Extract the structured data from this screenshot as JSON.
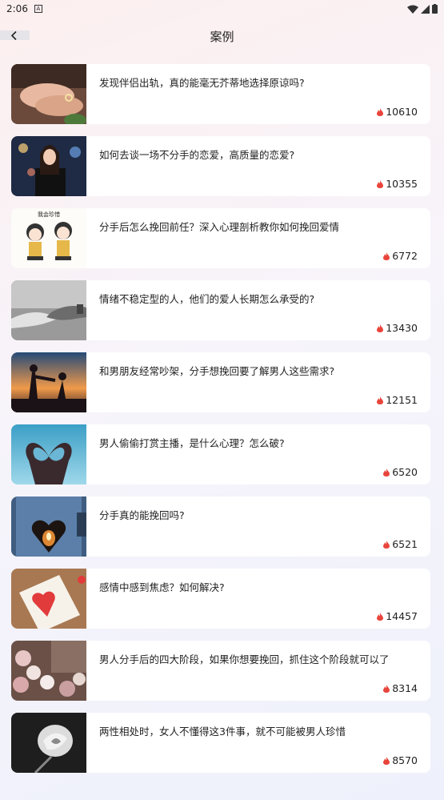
{
  "status": {
    "time": "2:06",
    "badge": "A"
  },
  "header": {
    "title": "案例"
  },
  "cases": [
    {
      "title": "发现伴侣出轨，真的能毫无芥蒂地选择原谅吗?",
      "views": "10610",
      "img": "hands"
    },
    {
      "title": "如何去谈一场不分手的恋爱，高质量的恋爱?",
      "views": "10355",
      "img": "woman"
    },
    {
      "title": "分手后怎么挽回前任？深入心理剖析教你如何挽回爱情",
      "views": "6772",
      "img": "cartoon",
      "img_text": "我会珍惜"
    },
    {
      "title": "情绪不稳定型的人，他们的爱人长期怎么承受的?",
      "views": "13430",
      "img": "handhold"
    },
    {
      "title": "和男朋友经常吵架，分手想挽回要了解男人这些需求?",
      "views": "12151",
      "img": "sunset"
    },
    {
      "title": "男人偷偷打赏主播，是什么心理？怎么破?",
      "views": "6520",
      "img": "heartsky"
    },
    {
      "title": "分手真的能挽回吗?",
      "views": "6521",
      "img": "heartdoor"
    },
    {
      "title": "感情中感到焦虑？如何解决?",
      "views": "14457",
      "img": "heartcard"
    },
    {
      "title": "男人分手后的四大阶段，如果你想要挽回，抓住这个阶段就可以了",
      "views": "8314",
      "img": "flowers"
    },
    {
      "title": "两性相处时，女人不懂得这3件事，就不可能被男人珍惜",
      "views": "8570",
      "img": "rose"
    }
  ]
}
